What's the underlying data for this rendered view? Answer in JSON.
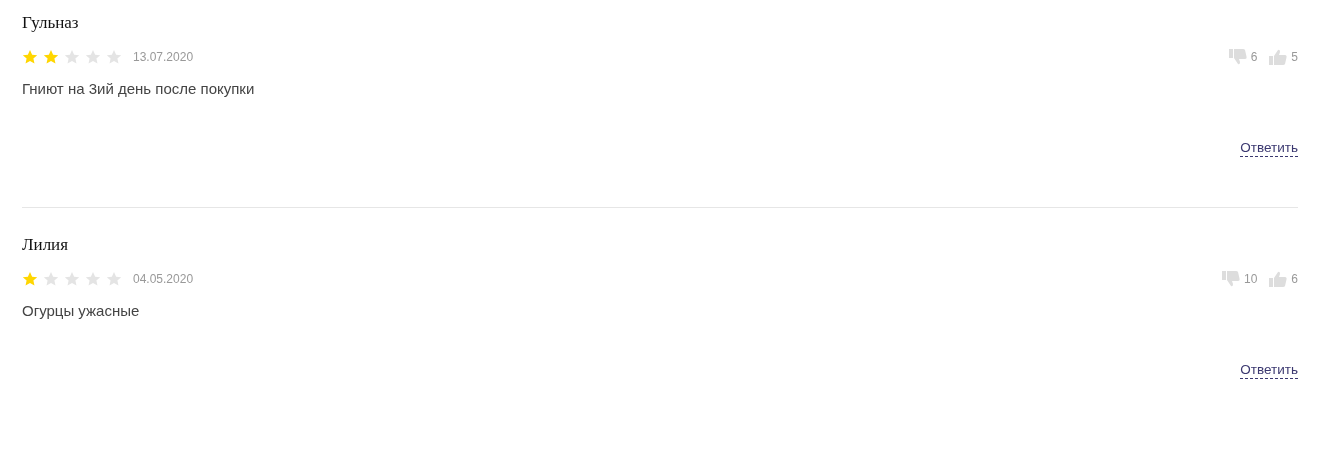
{
  "reviews": [
    {
      "author": "Гульназ",
      "stars": 2,
      "date": "13.07.2020",
      "dislikes": "6",
      "likes": "5",
      "text": "Гниют на 3ий день после покупки",
      "reply": "Ответить"
    },
    {
      "author": "Лилия",
      "stars": 1,
      "date": "04.05.2020",
      "dislikes": "10",
      "likes": "6",
      "text": "Огурцы ужасные",
      "reply": "Ответить"
    }
  ]
}
